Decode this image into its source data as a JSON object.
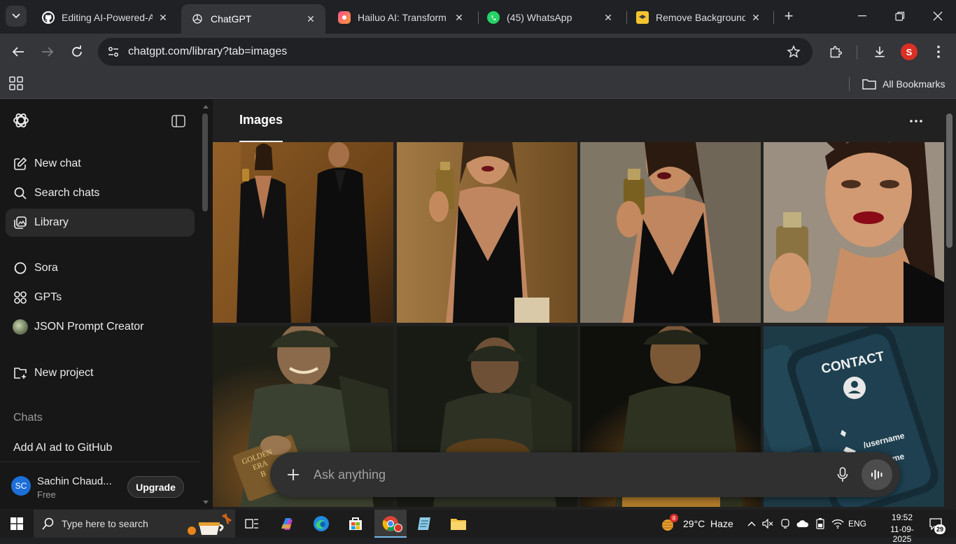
{
  "browser": {
    "tabs": [
      {
        "title": "Editing AI-Powered-A",
        "favicon": "github-icon"
      },
      {
        "title": "ChatGPT",
        "favicon": "openai-icon",
        "active": true
      },
      {
        "title": "Hailuo AI: Transform",
        "favicon": "hailuo-icon"
      },
      {
        "title": "(45) WhatsApp",
        "favicon": "whatsapp-icon"
      },
      {
        "title": "Remove Background",
        "favicon": "removebg-icon"
      }
    ],
    "url": "chatgpt.com/library?tab=images",
    "profile_initial": "S",
    "bookmarks_label": "All Bookmarks"
  },
  "sidebar": {
    "nav": [
      {
        "label": "New chat",
        "icon": "edit-icon"
      },
      {
        "label": "Search chats",
        "icon": "search-icon"
      },
      {
        "label": "Library",
        "icon": "library-icon",
        "active": true
      }
    ],
    "tools": [
      {
        "label": "Sora",
        "icon": "sora-icon"
      },
      {
        "label": "GPTs",
        "icon": "grid-icon"
      },
      {
        "label": "JSON Prompt Creator",
        "icon": "gpt-avatar"
      }
    ],
    "new_project": "New project",
    "chats_heading": "Chats",
    "chats": [
      "Add AI ad to GitHub"
    ],
    "user": {
      "initials": "SC",
      "name": "Sachin Chaud...",
      "plan": "Free",
      "upgrade": "Upgrade"
    }
  },
  "main": {
    "title": "Images",
    "images": [
      "woman-and-man-in-black-with-perfume",
      "woman-in-black-dress-holding-perfume",
      "woman-holding-perfume-bottle",
      "woman-closeup-with-perfume-bottle",
      "smiling-man-with-glowing-book",
      "laughing-man-with-book-in-forest",
      "man-looking-at-glowing-book",
      "contact-phone-graphic"
    ],
    "contact_card": {
      "heading": "CONTACT",
      "username": "/username",
      "name": "name"
    },
    "book_text": [
      "GOLDEN",
      "ERA",
      "B"
    ]
  },
  "composer": {
    "placeholder": "Ask anything"
  },
  "taskbar": {
    "search_placeholder": "Type here to search",
    "weather_badge": "8",
    "weather": "29°C  Haze",
    "language": "ENG",
    "time": "19:52",
    "date": "11-09-2025",
    "notifications": "29"
  }
}
